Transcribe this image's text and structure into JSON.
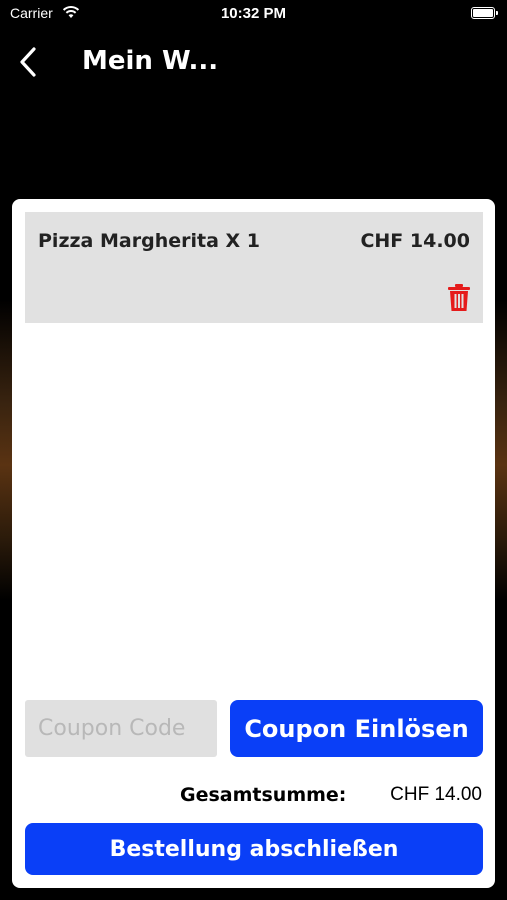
{
  "status_bar": {
    "carrier": "Carrier",
    "time": "10:32 PM"
  },
  "nav": {
    "title": "Mein W...",
    "back_icon": "chevron-left-icon"
  },
  "cart": {
    "items": [
      {
        "name": "Pizza Margherita X 1",
        "price": "CHF 14.00",
        "delete_icon": "trash-icon"
      }
    ],
    "coupon": {
      "placeholder": "Coupon Code",
      "value": "",
      "button_label": "Coupon Einlösen"
    },
    "total": {
      "label": "Gesamtsumme:",
      "value": "CHF 14.00"
    },
    "checkout_label": "Bestellung abschließen"
  },
  "colors": {
    "accent": "#0a3ff7",
    "delete": "#e51b1b",
    "item_bg": "#e1e1e1"
  }
}
